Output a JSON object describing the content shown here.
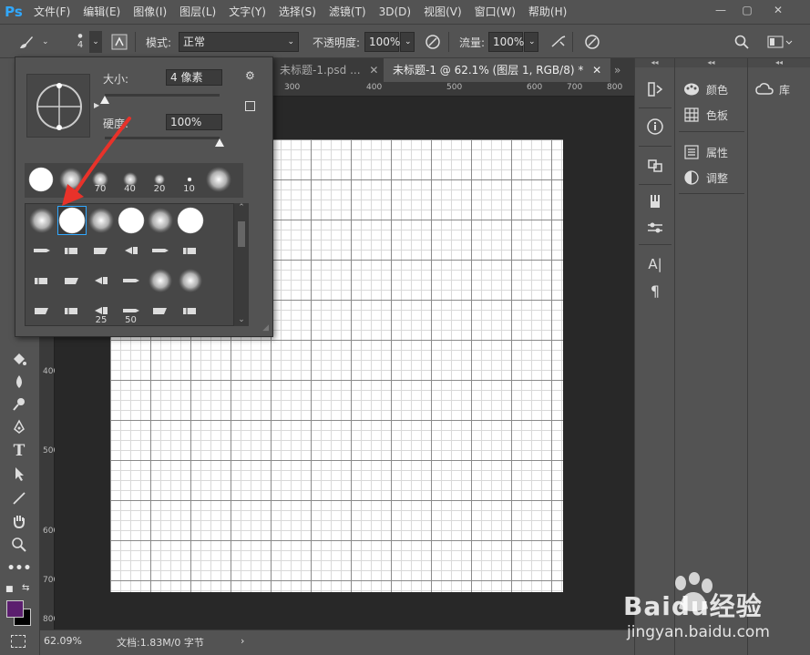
{
  "app": {
    "logo": "Ps"
  },
  "menu": [
    "文件(F)",
    "编辑(E)",
    "图像(I)",
    "图层(L)",
    "文字(Y)",
    "选择(S)",
    "滤镜(T)",
    "3D(D)",
    "视图(V)",
    "窗口(W)",
    "帮助(H)"
  ],
  "window_controls": {
    "minimize": "—",
    "restore": "▢",
    "close": "✕"
  },
  "options": {
    "brush_size_value": "4",
    "mode_label": "模式:",
    "mode_value": "正常",
    "opacity_label": "不透明度:",
    "opacity_value": "100%",
    "flow_label": "流量:",
    "flow_value": "100%"
  },
  "tabs": [
    {
      "label": "未标题-1.psd ...",
      "close": "✕"
    },
    {
      "label": "未标题-1 @ 62.1% (图层 1, RGB/8) *",
      "close": "✕"
    }
  ],
  "tabs_overflow": "»",
  "ruler": {
    "top": [
      "300",
      "400",
      "500",
      "600",
      "700",
      "800"
    ],
    "left": [
      "400",
      "500",
      "600",
      "700",
      "800"
    ]
  },
  "brush_panel": {
    "size_label": "大小:",
    "size_value": "4 像素",
    "hardness_label": "硬度:",
    "hardness_value": "100%",
    "size_level": 0.0,
    "hardness_level": 1.0,
    "preset_row_numbers": [
      "",
      "",
      "70",
      "40",
      "20",
      "10",
      ""
    ],
    "grid_numbers": [
      "",
      "",
      "",
      "",
      "",
      "",
      "",
      "",
      "",
      "",
      "",
      "",
      "",
      "",
      "",
      "",
      "",
      "",
      "",
      "",
      "25",
      "50",
      "",
      ""
    ]
  },
  "status": {
    "zoom": "62.09%",
    "doc": "文档:1.83M/0 字节",
    "arrow": "›"
  },
  "right_panels": [
    {
      "icon": "palette-icon",
      "label": "颜色"
    },
    {
      "icon": "swatches-icon",
      "label": "色板"
    },
    {
      "icon": "properties-icon",
      "label": "属性"
    },
    {
      "icon": "adjustments-icon",
      "label": "调整"
    }
  ],
  "library": {
    "label": "库"
  },
  "watermark": {
    "brand": "Baidu经验",
    "url": "jingyan.baidu.com"
  },
  "colors": {
    "foreground": "#5b1e6e",
    "background": "#000000",
    "accent": "#31a8ff",
    "arrow": "#e8322a"
  }
}
